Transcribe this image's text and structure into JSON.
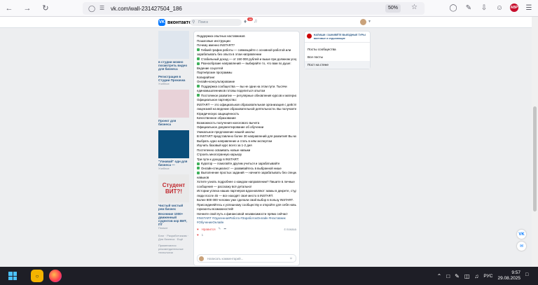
{
  "browser": {
    "url": "vk.com/wall-231427504_186",
    "zoom": "50%"
  },
  "vk": {
    "logo": "вконтакте",
    "search_placeholder": "Поиск",
    "notif_count": "16"
  },
  "ads": [
    {
      "title": "в студии можно посмотреть видео для бизнеса",
      "text": ""
    },
    {
      "title": "Регистрация в Студии Прокачка",
      "text": "Учебное"
    },
    {
      "title": "Проект для бизнеса",
      "text": "Учебное"
    },
    {
      "title": "\"Узнавай\" одн для бизнеса —",
      "text": "Учебное"
    },
    {
      "title": "Чистый чистый рем бизнес",
      "text": "Учебное"
    },
    {
      "title": "Весенние 1000+ движенный судентов кор ВИТ, ПТ",
      "text": "Плачит"
    }
  ],
  "student_ad": {
    "line1": "Студент",
    "line2": "ВИТ?!"
  },
  "footer_links": "Блог · Разработчикам · Для бизнеса · Ещё",
  "footer_note": "Применяются рекомендательные технологии",
  "post": {
    "lines": [
      {
        "text": "Поддержка опытных наставников",
        "check": false
      },
      {
        "text": "Пошаговые инструкции",
        "check": false
      },
      {
        "text": "Почему именно INSTART?",
        "check": false
      },
      {
        "text": "Гибкий график работы — совмещайте с основной работой или",
        "check": true
      },
      {
        "text": "зарабатывать без опыта в этом направлении",
        "check": false
      },
      {
        "text": "Стабильный доход — от 150 000 рублей и выше при должном усердии",
        "check": true
      },
      {
        "text": "Разнообразие направлений — выбирайте то, что вам по душе:",
        "check": true
      },
      {
        "text": "Ведение соцсетей",
        "check": false
      },
      {
        "text": "Партнёрские программы",
        "check": false
      },
      {
        "text": "Копирайтинг",
        "check": false
      },
      {
        "text": "Онлайн-консультирование",
        "check": false
      },
      {
        "text": "Поддержка сообщества — вы не одни на этом пути. Тысячи",
        "check": true
      },
      {
        "text": "единомышленников готовы поделиться опытом",
        "check": false
      },
      {
        "text": "Постоянное развитие — регулярные обновления курсов и материалов",
        "check": true
      },
      {
        "text": "Официальное партнёрство:",
        "check": false
      },
      {
        "text": "INSTART — это официальная образовательная организация с действующей",
        "check": false
      },
      {
        "text": "лицензией на ведение образовательной деятельности. Вы получаете:",
        "check": false
      },
      {
        "text": "Юридическую защищённость",
        "check": false
      },
      {
        "text": "Качественное образование",
        "check": false
      },
      {
        "text": "Возможность получения налогового вычета",
        "check": false
      },
      {
        "text": "Официальное документирование об обучении",
        "check": false
      },
      {
        "text": "Уникальное предложение нашей школы:",
        "check": false
      },
      {
        "text": "В INSTART представлено более 30 направлений для развития! Вы можете:",
        "check": false
      },
      {
        "text": "Выбрать одно направление и стать в нём экспертом",
        "check": false
      },
      {
        "text": "Изучить базовый курс всего за 1-2 дня",
        "check": false
      },
      {
        "text": "Постепенно осваивать новые навыки",
        "check": false
      },
      {
        "text": "Строить многогранную карьеру",
        "check": false
      },
      {
        "text": "Три пути к доходу в INSTART:",
        "check": false
      },
      {
        "text": "Куратор — помогайте другим учиться и зарабатывайте",
        "check": true
      },
      {
        "text": "Онлайн-специалист — развивайтесь в выбранной нише",
        "check": true
      },
      {
        "text": "Выполнение простых заданий — начните зарабатывать без специальных",
        "check": true
      },
      {
        "text": "навыков",
        "check": false
      },
      {
        "text": "Хотите узнать подробнее о каждом направлении? Пишите в личные",
        "check": false
      },
      {
        "text": "сообщения — расскажу всё детально!",
        "check": false
      },
      {
        "text": "Истории успеха наших партнёров вдохновляют: мамы в декрете, студенты,",
        "check": false
      },
      {
        "text": "люди после 45 — все находят своё место в INSTART.",
        "check": false
      },
      {
        "text": "Более 800 000 человек уже сделали свой выбор в пользу INSTART.",
        "check": false
      },
      {
        "text": "Присоединяйтесь к успешному сообществу и откройте для себя новые",
        "check": false
      },
      {
        "text": "горизонты возможностей!",
        "check": false
      },
      {
        "text": "Начните свой путь к финансовой независимости прямо сейчас!",
        "check": false
      }
    ],
    "hashtags": "#INSTART #УдаленнаяРабота #ЗаработокОнлайн #Наставник #ОбучениеОнлайн",
    "like_label": "Нравится",
    "like_count": "1",
    "views": "4 показа",
    "comment_placeholder": "Написать комментарий..."
  },
  "right": {
    "group_name": "НАПИШИ / ЗАЖИВЁТЕ ВЫЕЗДНЫЕ ТУРЫ вахтовые и отдыхающие",
    "items": [
      "Посты сообщества",
      "Все посты",
      "Пост на стене"
    ]
  },
  "taskbar": {
    "time": "9:57",
    "date": "29.08.2025",
    "lang": "РУС"
  }
}
